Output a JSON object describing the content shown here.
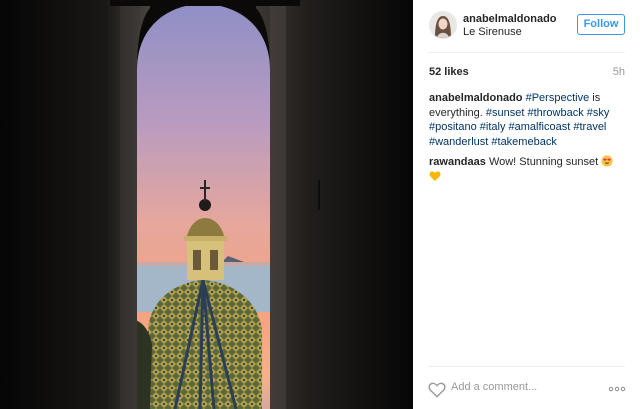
{
  "post": {
    "username": "anabelmaldonado",
    "location": "Le Sirenuse",
    "follow_label": "Follow",
    "likes": "52 likes",
    "time": "5h",
    "photo_subject": "arched-view-of-sunset-dome"
  },
  "caption": {
    "user": "anabelmaldonado",
    "tags": [
      "#Perspective",
      "#sunset",
      "#throwback",
      "#sky",
      "#positano",
      "#italy",
      "#amalficoast",
      "#travel",
      "#wanderlust",
      "#takemeback"
    ],
    "text_is": "is",
    "text_everything": "everything."
  },
  "comments": [
    {
      "user": "rawandaas",
      "text": "Wow! Stunning sunset"
    }
  ],
  "footer": {
    "add_comment_placeholder": "Add a comment...",
    "icons": [
      "heart-icon",
      "more-options-icon"
    ]
  },
  "colors": {
    "accent": "#3897f0",
    "hashtag": "#003569"
  }
}
